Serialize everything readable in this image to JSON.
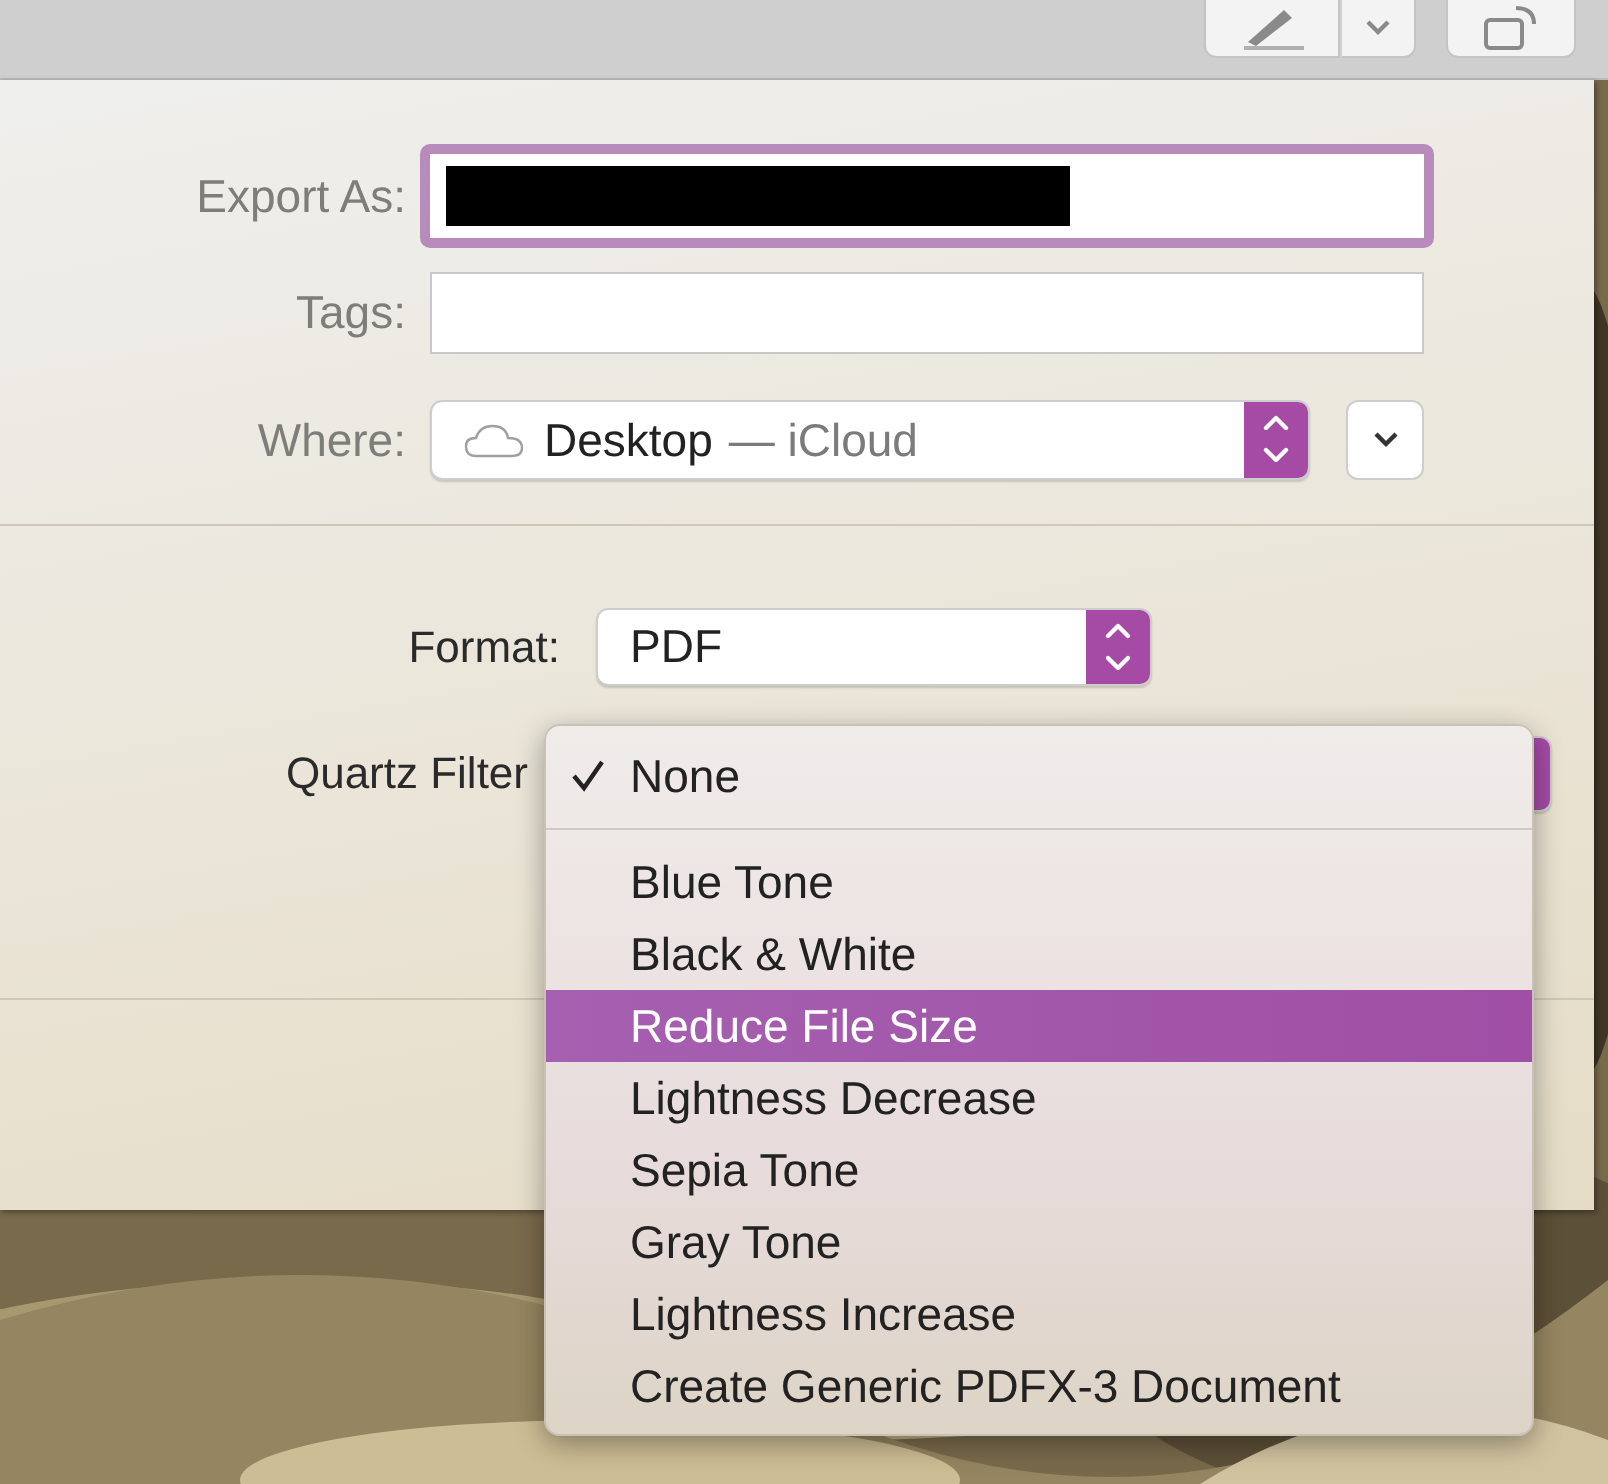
{
  "toolbar": {
    "buttons": [
      {
        "kind": "markup"
      },
      {
        "kind": "rotate"
      }
    ]
  },
  "export_as": {
    "label": "Export As:",
    "focused": true,
    "redacted": true
  },
  "tags": {
    "label": "Tags:"
  },
  "where": {
    "label": "Where:",
    "folder": "Desktop",
    "location": "— iCloud"
  },
  "format": {
    "label": "Format:",
    "value": "PDF"
  },
  "quartz_filter": {
    "label": "Quartz Filter",
    "menu": [
      {
        "label": "None",
        "checked": true,
        "selected": false
      },
      {
        "label": "Blue Tone",
        "checked": false,
        "selected": false
      },
      {
        "label": "Black & White",
        "checked": false,
        "selected": false
      },
      {
        "label": "Reduce File Size",
        "checked": false,
        "selected": true
      },
      {
        "label": "Lightness Decrease",
        "checked": false,
        "selected": false
      },
      {
        "label": "Sepia Tone",
        "checked": false,
        "selected": false
      },
      {
        "label": "Gray Tone",
        "checked": false,
        "selected": false
      },
      {
        "label": "Lightness Increase",
        "checked": false,
        "selected": false
      },
      {
        "label": "Create Generic PDFX-3 Document",
        "checked": false,
        "selected": false
      }
    ]
  }
}
